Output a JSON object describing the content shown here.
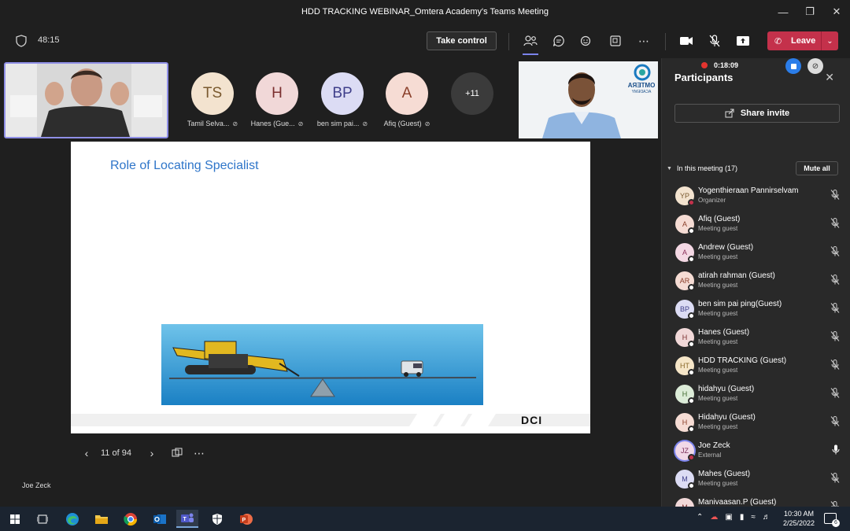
{
  "window": {
    "title": "HDD TRACKING WEBINAR_Omtera Academy's Teams Meeting"
  },
  "toolbar": {
    "timer": "48:15",
    "take_control": "Take control",
    "leave": "Leave"
  },
  "tiles": [
    {
      "initials": "TS",
      "name": "Tamil Selva...",
      "bg": "#f3e3cf",
      "fg": "#7a5a2f"
    },
    {
      "initials": "H",
      "name": "Hanes (Gue...",
      "bg": "#f1d8d8",
      "fg": "#7a2f2f"
    },
    {
      "initials": "BP",
      "name": "ben sim pai...",
      "bg": "#dcdcf4",
      "fg": "#3f3f8a"
    },
    {
      "initials": "A",
      "name": "Afiq (Guest)",
      "bg": "#f6dcd4",
      "fg": "#8a3f2a"
    },
    {
      "initials": "+11",
      "name": "",
      "bg": "#3b3b3b",
      "fg": "#ffffff"
    }
  ],
  "slide": {
    "title": "Role of Locating Specialist",
    "page": "11 of 94",
    "logo": "DCI"
  },
  "presenter": {
    "name": "Joe Zeck"
  },
  "guest_logo": {
    "line1": "OMTERA",
    "line2": "ACADEMY"
  },
  "panel": {
    "title": "Participants",
    "recording_time": "0:18:09",
    "share_invite": "Share invite",
    "in_meeting": "In this meeting (17)",
    "mute_all": "Mute all",
    "participants": [
      {
        "initials": "YP",
        "name": "Yogenthieraan Pannirselvam",
        "role": "Organizer",
        "bg": "#f3e3cf",
        "fg": "#7a5a2f",
        "status": "busy",
        "mic": "off"
      },
      {
        "initials": "A",
        "name": "Afiq (Guest)",
        "role": "Meeting guest",
        "bg": "#f6dcd4",
        "fg": "#8a3f2a",
        "status": "away",
        "mic": "off"
      },
      {
        "initials": "A",
        "name": "Andrew (Guest)",
        "role": "Meeting guest",
        "bg": "#f4d8e4",
        "fg": "#8a2f5a",
        "status": "away",
        "mic": "off"
      },
      {
        "initials": "AR",
        "name": "atirah rahman (Guest)",
        "role": "Meeting guest",
        "bg": "#f6dcd4",
        "fg": "#8a3f2a",
        "status": "away",
        "mic": "off"
      },
      {
        "initials": "BP",
        "name": "ben sim pai ping(Guest)",
        "role": "Meeting guest",
        "bg": "#dcdcf4",
        "fg": "#3f3f8a",
        "status": "away",
        "mic": "off"
      },
      {
        "initials": "H",
        "name": "Hanes (Guest)",
        "role": "Meeting guest",
        "bg": "#f1d8d8",
        "fg": "#7a2f2f",
        "status": "away",
        "mic": "off"
      },
      {
        "initials": "HT",
        "name": "HDD TRACKING (Guest)",
        "role": "Meeting guest",
        "bg": "#f6e6c8",
        "fg": "#8a6a2a",
        "status": "away",
        "mic": "off"
      },
      {
        "initials": "H",
        "name": "hidahyu (Guest)",
        "role": "Meeting guest",
        "bg": "#dcecd8",
        "fg": "#3f6a2f",
        "status": "away",
        "mic": "off"
      },
      {
        "initials": "H",
        "name": "Hidahyu (Guest)",
        "role": "Meeting guest",
        "bg": "#f6dcd4",
        "fg": "#8a3f2a",
        "status": "away",
        "mic": "off"
      },
      {
        "initials": "JZ",
        "name": "Joe Zeck",
        "role": "External",
        "bg": "#f1d8e8",
        "fg": "#7a2f5a",
        "status": "busy",
        "mic": "on",
        "ring": true
      },
      {
        "initials": "M",
        "name": "Mahes (Guest)",
        "role": "Meeting guest",
        "bg": "#dcdcf4",
        "fg": "#3f3f8a",
        "status": "away",
        "mic": "off"
      },
      {
        "initials": "M",
        "name": "Manivaasan.P (Guest)",
        "role": "",
        "bg": "#f1d8d8",
        "fg": "#7a2f2f",
        "status": "away",
        "mic": "off"
      }
    ]
  },
  "taskbar": {
    "time": "10:30 AM",
    "date": "2/25/2022",
    "notifications": "6"
  }
}
